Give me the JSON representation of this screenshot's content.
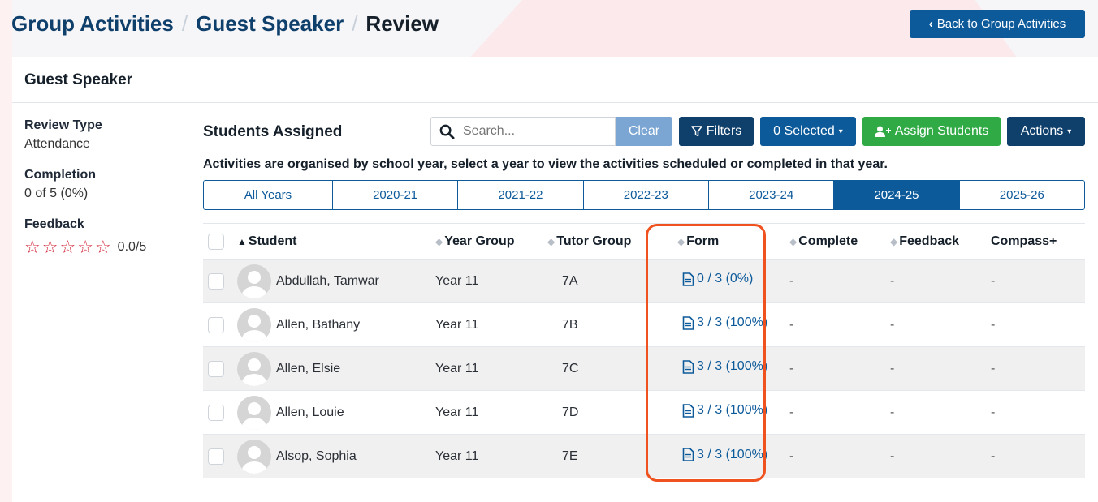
{
  "breadcrumb": {
    "items": [
      "Group Activities",
      "Guest Speaker",
      "Review"
    ],
    "separator": "/"
  },
  "back_button": {
    "label": "Back to Group Activities",
    "icon": "chevron-left-icon"
  },
  "card": {
    "title": "Guest Speaker"
  },
  "sidebar": {
    "review_type_label": "Review Type",
    "review_type_value": "Attendance",
    "completion_label": "Completion",
    "completion_value": "0 of 5 (0%)",
    "feedback_label": "Feedback",
    "rating": "0.0/5",
    "stars_filled": 0,
    "stars_total": 5
  },
  "main": {
    "section_title": "Students Assigned",
    "search_placeholder": "Search...",
    "clear_label": "Clear",
    "filters_label": "Filters",
    "selected_label": "0 Selected",
    "assign_label": "Assign Students",
    "actions_label": "Actions",
    "info_text": "Activities are organised by school year, select a year to view the activities scheduled or completed in that year.",
    "year_tabs": [
      "All Years",
      "2020-21",
      "2021-22",
      "2022-23",
      "2023-24",
      "2024-25",
      "2025-26"
    ],
    "active_year": "2024-25"
  },
  "table": {
    "headers": {
      "student": "Student",
      "year_group": "Year Group",
      "tutor_group": "Tutor Group",
      "form": "Form",
      "complete": "Complete",
      "feedback": "Feedback",
      "compass": "Compass+"
    },
    "rows": [
      {
        "student": "Abdullah, Tamwar",
        "year_group": "Year 11",
        "tutor_group": "7A",
        "form": "0 / 3 (0%)",
        "complete": "-",
        "feedback": "-",
        "compass": "-"
      },
      {
        "student": "Allen, Bathany",
        "year_group": "Year 11",
        "tutor_group": "7B",
        "form": "3 / 3 (100%)",
        "complete": "-",
        "feedback": "-",
        "compass": "-"
      },
      {
        "student": "Allen, Elsie",
        "year_group": "Year 11",
        "tutor_group": "7C",
        "form": "3 / 3 (100%)",
        "complete": "-",
        "feedback": "-",
        "compass": "-"
      },
      {
        "student": "Allen, Louie",
        "year_group": "Year 11",
        "tutor_group": "7D",
        "form": "3 / 3 (100%)",
        "complete": "-",
        "feedback": "-",
        "compass": "-"
      },
      {
        "student": "Alsop, Sophia",
        "year_group": "Year 11",
        "tutor_group": "7E",
        "form": "3 / 3 (100%)",
        "complete": "-",
        "feedback": "-",
        "compass": "-"
      }
    ]
  },
  "colors": {
    "primary": "#0d5a9b",
    "dark_primary": "#0f3f6b",
    "success": "#2faa44",
    "star": "#d42a3c",
    "highlight": "#f0521f"
  }
}
